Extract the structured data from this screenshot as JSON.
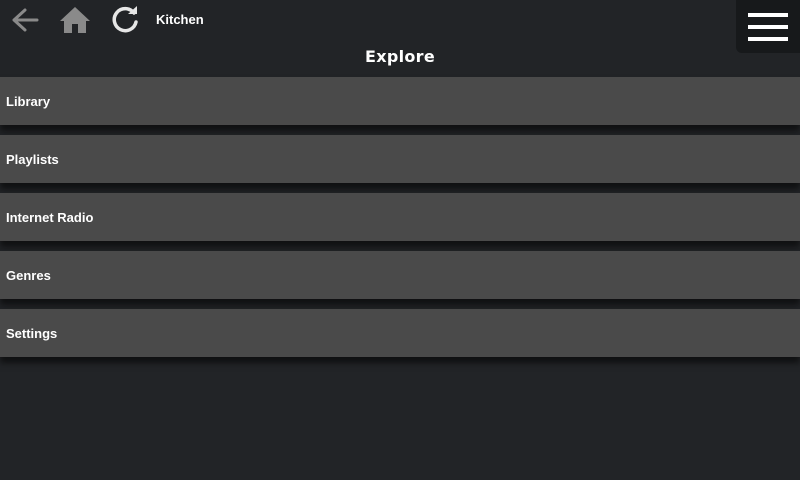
{
  "header": {
    "zone_name": "Kitchen",
    "icons": {
      "back": "arrow-left-icon",
      "home": "home-icon",
      "refresh": "refresh-icon",
      "menu": "hamburger-menu-icon"
    }
  },
  "page": {
    "title": "Explore"
  },
  "menu": {
    "items": [
      {
        "label": "Library"
      },
      {
        "label": "Playlists"
      },
      {
        "label": "Internet Radio"
      },
      {
        "label": "Genres"
      },
      {
        "label": "Settings"
      }
    ]
  },
  "colors": {
    "background": "#222427",
    "item_background": "#4a4a4a",
    "menu_button_background": "#17191b",
    "text": "#ffffff",
    "icon_dim": "#8a8a8a",
    "icon_light": "#e6e6e6"
  }
}
